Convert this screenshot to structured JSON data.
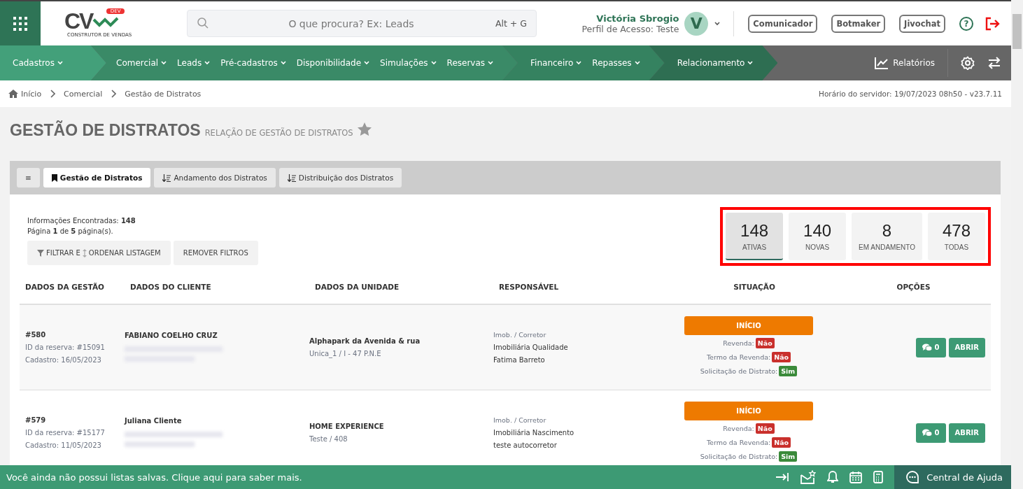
{
  "header": {
    "logo": {
      "text": "CV",
      "badge": "DEV",
      "subtitle": "CONSTRUTOR DE VENDAS"
    },
    "search": {
      "placeholder": "O que procura? Ex: Leads",
      "shortcut": "Alt + G"
    },
    "user": {
      "name": "Victória Sbrogio",
      "profile": "Perfil de Acesso: Teste",
      "initial": "V"
    },
    "buttons": [
      "Comunicador",
      "Botmaker",
      "Jivochat"
    ],
    "help": "?"
  },
  "nav": {
    "groups": [
      {
        "items": [
          "Cadastros"
        ]
      },
      {
        "items": [
          "Comercial",
          "Leads",
          "Pré-cadastros",
          "Disponibilidade",
          "Simulações",
          "Reservas"
        ]
      },
      {
        "items": [
          "Financeiro",
          "Repasses"
        ]
      },
      {
        "items": [
          "Relacionamento"
        ]
      }
    ],
    "reports": "Relatórios"
  },
  "breadcrumb": [
    "Início",
    "Comercial",
    "Gestão de Distratos"
  ],
  "server_time": "Horário do servidor: 19/07/2023 08h50 - v23.7.11",
  "page": {
    "title": "GESTÃO DE DISTRATOS",
    "subtitle": "RELAÇÃO DE GESTÃO DE DISTRATOS"
  },
  "tabs": [
    {
      "label": "≡",
      "kind": "menu",
      "selected": false
    },
    {
      "label": "Gestão de Distratos",
      "kind": "tab",
      "selected": true
    },
    {
      "label": "Andamento dos Distratos",
      "kind": "tab",
      "selected": false
    },
    {
      "label": "Distribuição dos Distratos",
      "kind": "tab",
      "selected": false
    }
  ],
  "summary": {
    "found": "Informações Encontradas: **148**",
    "pages": "Página **1** de **5** página(s)."
  },
  "actions": [
    "FILTRAR E",
    "ORDENAR LISTAGEM",
    "REMOVER FILTROS"
  ],
  "counters": [
    {
      "value": "148",
      "label": "ATIVAS",
      "selected": true
    },
    {
      "value": "140",
      "label": "NOVAS",
      "selected": false
    },
    {
      "value": "8",
      "label": "EM ANDAMENTO",
      "selected": false
    },
    {
      "value": "478",
      "label": "TODAS",
      "selected": false
    }
  ],
  "table": {
    "columns": [
      "DADOS DA GESTÃO",
      "DADOS DO CLIENTE",
      "DADOS DA UNIDADE",
      "RESPONSÁVEL",
      "SITUAÇÃO",
      "OPÇÕES"
    ],
    "rows": [
      {
        "id": "#580",
        "reservation": "ID da reserva: #15091",
        "date": "Cadastro: 16/05/2023",
        "client": "FABIANO COELHO CRUZ",
        "unit": "Alphapark da Avenida & rua",
        "unit_detail": "Unica_1 / I - 47 P.N.E",
        "resp_label": "Imob. / Corretor",
        "agency": "Imobiliária Qualidade",
        "broker": "Fatima Barreto",
        "status": "INÍCIO",
        "flags": [
          {
            "label": "Revenda:",
            "value": "Não",
            "kind": "negative"
          },
          {
            "label": "Termo da Revenda:",
            "value": "Não",
            "kind": "negative"
          },
          {
            "label": "Solicitação de Distrato:",
            "value": "Sim",
            "kind": "positive"
          }
        ],
        "messages": "0",
        "open": "ABRIR"
      },
      {
        "id": "#579",
        "reservation": "ID da reserva: #15177",
        "date": "Cadastro: 11/05/2023",
        "client": "Juliana Cliente",
        "unit": "HOME EXPERIENCE",
        "unit_detail": "Teste / 408",
        "resp_label": "Imob. / Corretor",
        "agency": "Imobiliária Nascimento",
        "broker": "teste autocorretor",
        "status": "INÍCIO",
        "flags": [
          {
            "label": "Revenda:",
            "value": "Não",
            "kind": "negative"
          },
          {
            "label": "Termo da Revenda:",
            "value": "Não",
            "kind": "negative"
          },
          {
            "label": "Solicitação de Distrato:",
            "value": "Sim",
            "kind": "positive"
          }
        ],
        "messages": "0",
        "open": "ABRIR"
      }
    ]
  },
  "footer": {
    "message": "Você ainda não possui listas salvas. Clique aqui para saber mais.",
    "help": "Central de Ajuda"
  }
}
